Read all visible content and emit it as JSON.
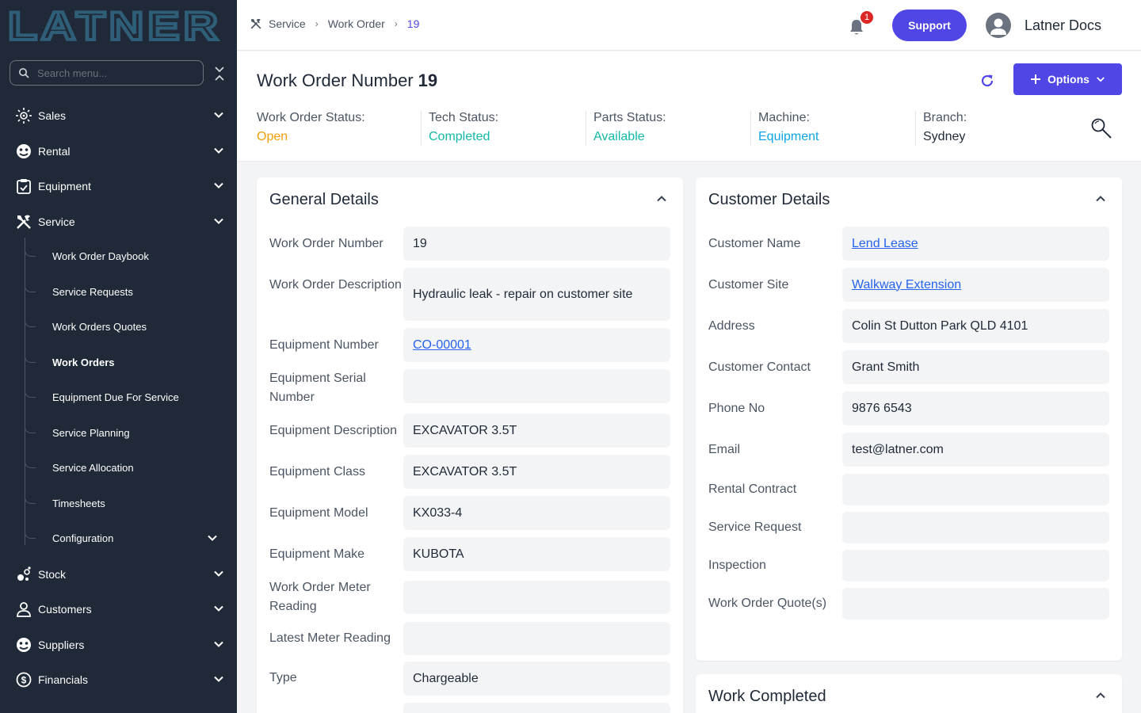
{
  "brand": {
    "logo_text": "LATNER"
  },
  "search": {
    "placeholder": "Search menu..."
  },
  "sidebar": {
    "items": [
      {
        "label": "Sales"
      },
      {
        "label": "Rental"
      },
      {
        "label": "Equipment"
      },
      {
        "label": "Service"
      },
      {
        "label": "Stock"
      },
      {
        "label": "Customers"
      },
      {
        "label": "Suppliers"
      },
      {
        "label": "Financials"
      }
    ],
    "service_sub": [
      {
        "label": "Work Order Daybook"
      },
      {
        "label": "Service Requests"
      },
      {
        "label": "Work Orders Quotes"
      },
      {
        "label": "Work Orders"
      },
      {
        "label": "Equipment Due For Service"
      },
      {
        "label": "Service Planning"
      },
      {
        "label": "Service Allocation"
      },
      {
        "label": "Timesheets"
      },
      {
        "label": "Configuration"
      }
    ]
  },
  "topbar": {
    "breadcrumbs": [
      "Service",
      "Work Order",
      "19"
    ],
    "notifications": "1",
    "support_label": "Support",
    "user_name": "Latner Docs"
  },
  "header": {
    "title": "Work Order Number",
    "number": "19",
    "options_label": "Options",
    "stats": [
      {
        "label": "Work Order Status:",
        "value": "Open",
        "color": "#f59e0b"
      },
      {
        "label": "Tech Status:",
        "value": "Completed",
        "color": "#14b8a6"
      },
      {
        "label": "Parts Status:",
        "value": "Available",
        "color": "#14b8a6"
      },
      {
        "label": "Machine:",
        "value": "Equipment",
        "color": "#0ea5e9"
      },
      {
        "label": "Branch:",
        "value": "Sydney",
        "color": "#1f2937"
      }
    ]
  },
  "general": {
    "title": "General Details",
    "rows": [
      {
        "label": "Work Order Number",
        "value": "19"
      },
      {
        "label": "Work Order Description",
        "value": "Hydraulic leak - repair on customer site"
      },
      {
        "label": "Equipment Number",
        "value": "CO-00001"
      },
      {
        "label": "Equipment Serial Number",
        "value": ""
      },
      {
        "label": "Equipment Description",
        "value": "EXCAVATOR 3.5T"
      },
      {
        "label": "Equipment Class",
        "value": "EXCAVATOR 3.5T"
      },
      {
        "label": "Equipment Model",
        "value": "KX033-4"
      },
      {
        "label": "Equipment Make",
        "value": "KUBOTA"
      },
      {
        "label": "Work Order Meter Reading",
        "value": ""
      },
      {
        "label": "Latest Meter Reading",
        "value": ""
      },
      {
        "label": "Type",
        "value": "Chargeable"
      }
    ]
  },
  "customer": {
    "title": "Customer Details",
    "rows": [
      {
        "label": "Customer Name",
        "value": "Lend Lease"
      },
      {
        "label": "Customer Site",
        "value": "Walkway Extension"
      },
      {
        "label": "Address",
        "value": "Colin St Dutton Park QLD 4101"
      },
      {
        "label": "Customer Contact",
        "value": "Grant Smith"
      },
      {
        "label": "Phone No",
        "value": "9876 6543"
      },
      {
        "label": "Email",
        "value": "test@latner.com"
      },
      {
        "label": "Rental Contract",
        "value": ""
      },
      {
        "label": "Service Request",
        "value": ""
      },
      {
        "label": "Inspection",
        "value": ""
      },
      {
        "label": "Work Order Quote(s)",
        "value": ""
      }
    ]
  },
  "work_completed": {
    "title": "Work Completed"
  },
  "colors": {
    "sidebar_bg": "#1f2937",
    "accent": "#4f46e5",
    "link": "#2563eb",
    "logo": "#2f5f78"
  }
}
